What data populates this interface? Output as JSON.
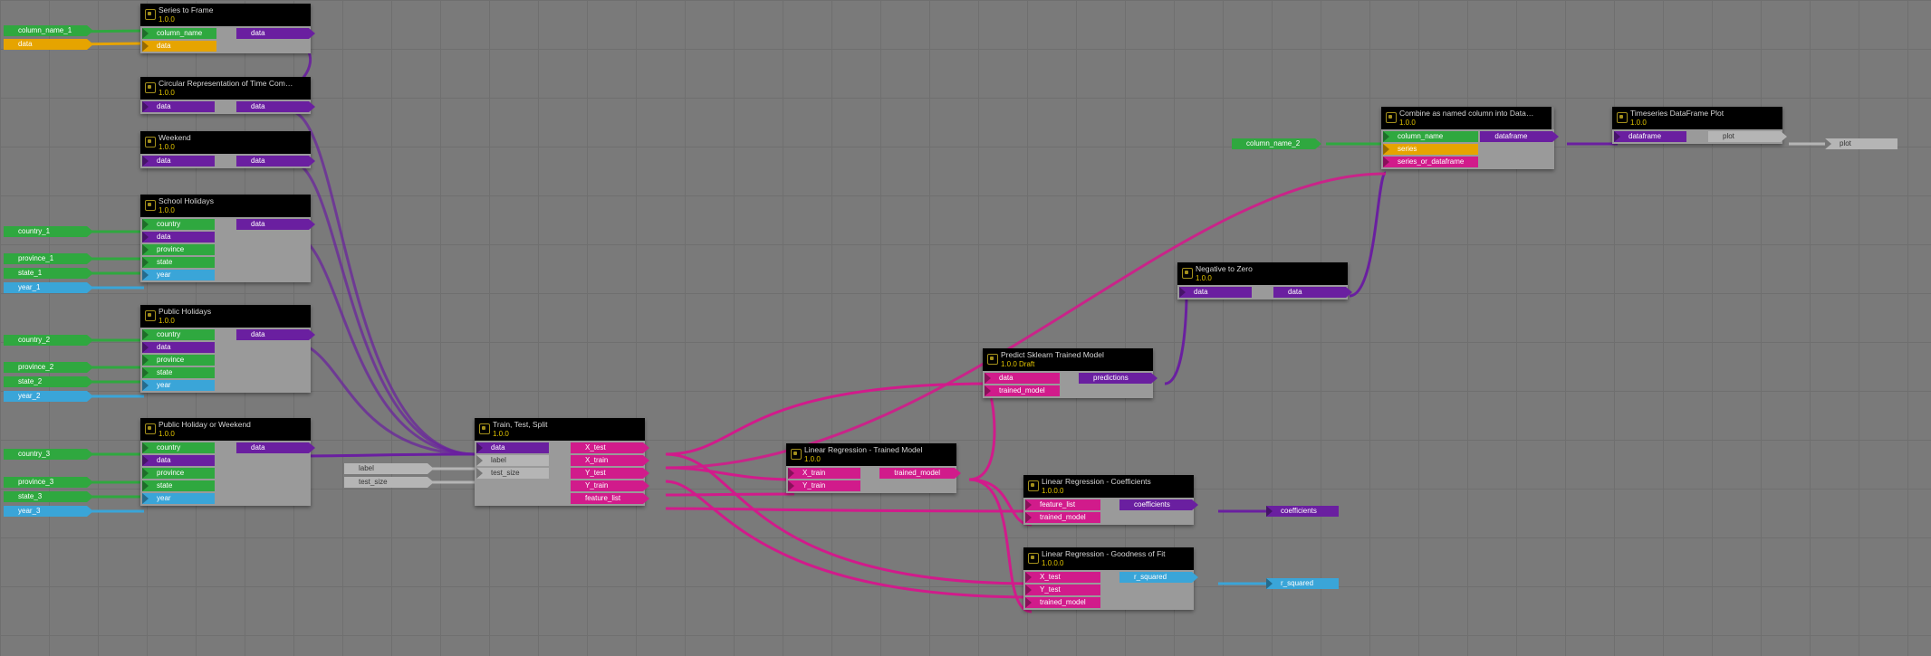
{
  "sources": {
    "column_name_1": "column_name_1",
    "data_s": "data",
    "country_1": "country_1",
    "province_1": "province_1",
    "state_1": "state_1",
    "year_1": "year_1",
    "country_2": "country_2",
    "province_2": "province_2",
    "state_2": "state_2",
    "year_2": "year_2",
    "country_3": "country_3",
    "province_3": "province_3",
    "state_3": "state_3",
    "year_3": "year_3",
    "label": "label",
    "test_size": "test_size",
    "column_name_2": "column_name_2"
  },
  "sinks": {
    "coefficients": "coefficients",
    "r_squared": "r_squared",
    "plot": "plot"
  },
  "nodes": {
    "series_to_frame": {
      "title": "Series to Frame",
      "ver": "1.0.0",
      "in": [
        "column_name",
        "data"
      ],
      "out": [
        "data"
      ]
    },
    "circ_time": {
      "title": "Circular Representation of Time Compo…",
      "ver": "1.0.0",
      "in": [
        "data"
      ],
      "out": [
        "data"
      ]
    },
    "weekend": {
      "title": "Weekend",
      "ver": "1.0.0",
      "in": [
        "data"
      ],
      "out": [
        "data"
      ]
    },
    "school_holidays": {
      "title": "School Holidays",
      "ver": "1.0.0",
      "in": [
        "country",
        "data",
        "province",
        "state",
        "year"
      ],
      "out": [
        "data"
      ]
    },
    "public_holidays": {
      "title": "Public Holidays",
      "ver": "1.0.0",
      "in": [
        "country",
        "data",
        "province",
        "state",
        "year"
      ],
      "out": [
        "data"
      ]
    },
    "public_or_weekend": {
      "title": "Public Holiday or Weekend",
      "ver": "1.0.0",
      "in": [
        "country",
        "data",
        "province",
        "state",
        "year"
      ],
      "out": [
        "data"
      ]
    },
    "tts": {
      "title": "Train, Test, Split",
      "ver": "1.0.0",
      "in": [
        "data",
        "label",
        "test_size"
      ],
      "out": [
        "X_test",
        "X_train",
        "Y_test",
        "Y_train",
        "feature_list"
      ]
    },
    "lr_trained": {
      "title": "Linear Regression - Trained Model",
      "ver": "1.0.0",
      "in": [
        "X_train",
        "Y_train"
      ],
      "out": [
        "trained_model"
      ]
    },
    "predict": {
      "title": "Predict Sklearn Trained Model",
      "ver": "1.0.0 Draft",
      "in": [
        "data",
        "trained_model"
      ],
      "out": [
        "predictions"
      ]
    },
    "lr_coef": {
      "title": "Linear Regression - Coefficients",
      "ver": "1.0.0.0",
      "in": [
        "feature_list",
        "trained_model"
      ],
      "out": [
        "coefficients"
      ]
    },
    "lr_fit": {
      "title": "Linear Regression - Goodness of Fit",
      "ver": "1.0.0.0",
      "in": [
        "X_test",
        "Y_test",
        "trained_model"
      ],
      "out": [
        "r_squared"
      ]
    },
    "neg_zero": {
      "title": "Negative to Zero",
      "ver": "1.0.0",
      "in": [
        "data"
      ],
      "out": [
        "data"
      ]
    },
    "combine": {
      "title": "Combine as named column into DataFra…",
      "ver": "1.0.0",
      "in": [
        "column_name",
        "series",
        "series_or_dataframe"
      ],
      "out": [
        "dataframe"
      ]
    },
    "ts_plot": {
      "title": "Timeseries DataFrame Plot",
      "ver": "1.0.0",
      "in": [
        "dataframe"
      ],
      "out": [
        "plot"
      ]
    }
  }
}
